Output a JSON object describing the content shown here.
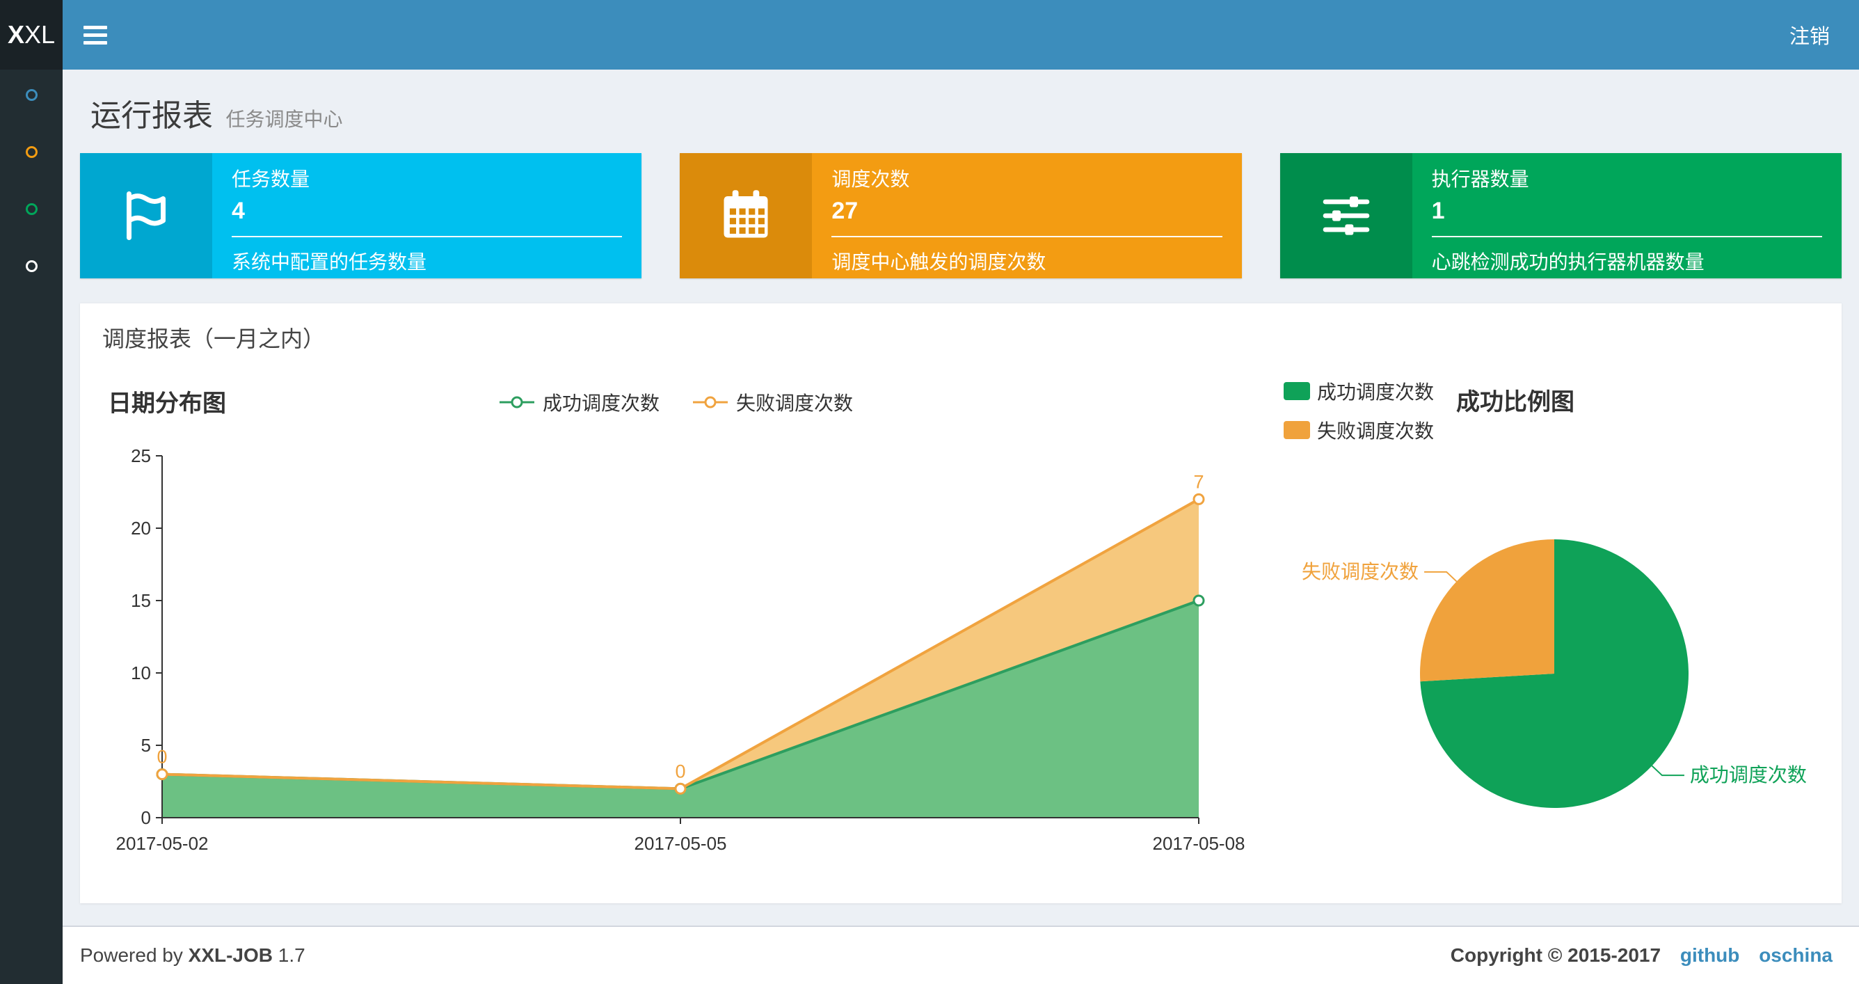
{
  "navbar": {
    "logo_bold": "X",
    "logo_rest": "XL",
    "logout_label": "注销"
  },
  "sidebar": {
    "items": [
      {
        "color": "#3c8dbc"
      },
      {
        "color": "#f39c12"
      },
      {
        "color": "#00a65a"
      },
      {
        "color": "#ffffff"
      }
    ]
  },
  "page_header": {
    "title": "运行报表",
    "subtitle": "任务调度中心"
  },
  "info_boxes": [
    {
      "title": "任务数量",
      "value": "4",
      "description": "系统中配置的任务数量",
      "color": "#00c0ef",
      "icon_color": "#00a7d0",
      "icon": "flag-icon"
    },
    {
      "title": "调度次数",
      "value": "27",
      "description": "调度中心触发的调度次数",
      "color": "#f39c12",
      "icon_color": "#db8b0b",
      "icon": "calendar-icon"
    },
    {
      "title": "执行器数量",
      "value": "1",
      "description": "心跳检测成功的执行器机器数量",
      "color": "#00a65a",
      "icon_color": "#008d4c",
      "icon": "sliders-icon"
    }
  ],
  "report_panel": {
    "title": "调度报表（一月之内）"
  },
  "chart_data": [
    {
      "type": "area",
      "title": "日期分布图",
      "x": [
        "2017-05-02",
        "2017-05-05",
        "2017-05-08"
      ],
      "series": [
        {
          "name": "成功调度次数",
          "values": [
            3,
            2,
            15
          ],
          "color": "#2d9e5f",
          "fill": "#6cc183",
          "stack": true
        },
        {
          "name": "失败调度次数",
          "values": [
            0,
            0,
            7
          ],
          "color": "#f0a33f",
          "fill": "#f6c87d",
          "stack": true,
          "point_labels": [
            "0",
            "0",
            "7"
          ]
        }
      ],
      "ylim": [
        0,
        25
      ],
      "y_ticks": [
        0,
        5,
        10,
        15,
        20,
        25
      ],
      "legend_position": "top",
      "grid": false
    },
    {
      "type": "pie",
      "title": "成功比例图",
      "legend": [
        "成功调度次数",
        "失败调度次数"
      ],
      "slices": [
        {
          "name": "成功调度次数",
          "value": 20,
          "color": "#0fa258"
        },
        {
          "name": "失败调度次数",
          "value": 7,
          "color": "#f0a23c"
        }
      ],
      "start_angle": 90,
      "clockwise": true
    }
  ],
  "footer": {
    "powered_by_prefix": "Powered by",
    "product": "XXL-JOB",
    "version": "1.7",
    "copyright": "Copyright © 2015-2017",
    "links": [
      "github",
      "oschina"
    ]
  }
}
